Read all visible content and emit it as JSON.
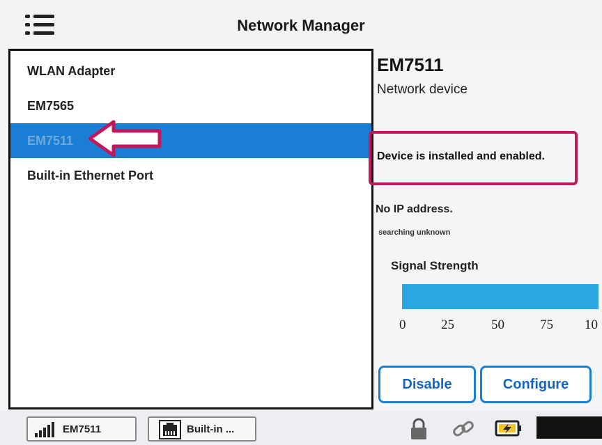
{
  "header": {
    "title": "Network Manager",
    "menu_icon": "hamburger-menu-icon"
  },
  "devices": {
    "items": [
      {
        "label": "WLAN Adapter",
        "selected": false
      },
      {
        "label": "EM7565",
        "selected": false
      },
      {
        "label": "EM7511",
        "selected": true
      },
      {
        "label": "Built-in Ethernet Port",
        "selected": false
      }
    ]
  },
  "detail": {
    "name": "EM7511",
    "type": "Network device",
    "status": "Device is installed and enabled.",
    "ip": "No IP address.",
    "search_status": "searching unknown",
    "signal": {
      "label": "Signal Strength",
      "value_percent": 100,
      "ticks": [
        "0",
        "25",
        "50",
        "75",
        "10"
      ]
    },
    "buttons": {
      "disable": "Disable",
      "configure": "Configure"
    }
  },
  "taskbar": {
    "items": [
      {
        "label": "EM7511",
        "icon": "signal-bars-icon"
      },
      {
        "label": "Built-in ...",
        "icon": "ethernet-port-icon"
      }
    ],
    "tray_icons": [
      "lock-icon",
      "link-icon",
      "battery-charging-icon"
    ]
  },
  "colors": {
    "accent": "#1a7fd4",
    "highlight": "#c2185b",
    "signal": "#2aa7e0"
  }
}
